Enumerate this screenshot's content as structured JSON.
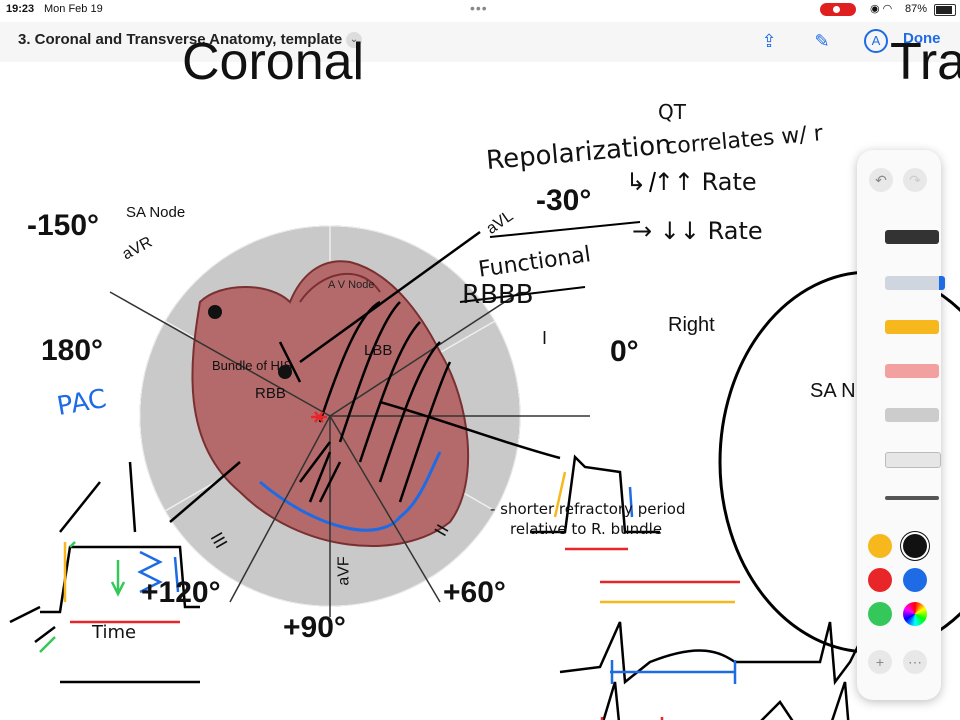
{
  "status": {
    "time": "19:23",
    "date": "Mon Feb 19",
    "battery": "87%"
  },
  "toolbar": {
    "title": "3. Coronal and Transverse Anatomy, template",
    "done": "Done"
  },
  "slide": {
    "heading_left": "Coronal",
    "heading_right": "Tra",
    "sa_node": "SA Node",
    "av_node": "A V Node",
    "bundle_his": "Bundle of HIS",
    "lbb": "LBB",
    "rbb": "RBB",
    "deg_m150": "-150°",
    "deg_m30": "-30°",
    "deg_180": "180°",
    "deg_0": "0°",
    "deg_120": "+120°",
    "deg_90": "+90°",
    "deg_60": "+60°",
    "avr": "aVR",
    "avl": "aVL",
    "avf": "aVF",
    "lead_i": "I",
    "lead_ii": "II",
    "lead_iii": "III",
    "right": "Right",
    "sa_n": "SA N"
  },
  "annotations": {
    "qt": "QT",
    "repol": "Repolarization",
    "correlates": "correlates w/ r",
    "rate_up": "↳ ↑↑ Rate",
    "rate_down": "→ ↓↓ Rate",
    "functional": "Functional",
    "rbbb": "RBBB",
    "pac": "PAC",
    "time": "Time",
    "shorter1": "- shorter refractory period",
    "shorter2": "relative to R. bundle"
  },
  "palette": {
    "colors": [
      "#f6b81c",
      "#111111",
      "#e8262a",
      "#1e6be6",
      "#34c759"
    ]
  }
}
